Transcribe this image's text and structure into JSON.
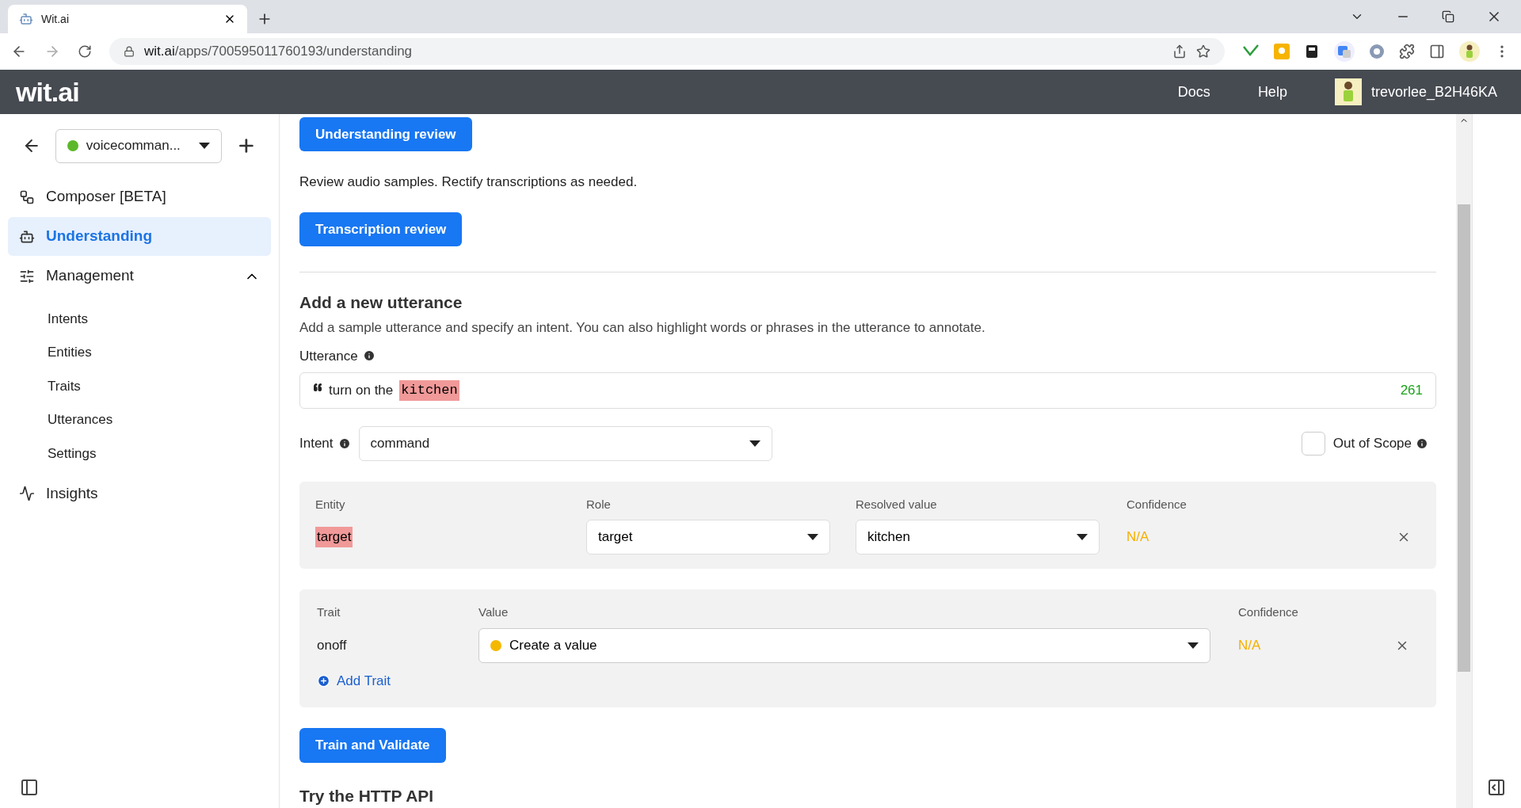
{
  "browser": {
    "tab": {
      "title": "Wit.ai"
    },
    "url": {
      "host": "wit.ai",
      "path": "/apps/700595011760193/understanding"
    }
  },
  "header": {
    "logo": "wit.ai",
    "links": [
      "Docs",
      "Help"
    ],
    "user": "trevorlee_B2H46KA"
  },
  "sidebar": {
    "app": {
      "name": "voicecomman...",
      "color": "#5cb82a"
    },
    "items": [
      {
        "label": "Composer [BETA]",
        "selected": false
      },
      {
        "label": "Understanding",
        "selected": true
      },
      {
        "label": "Management",
        "selected": false,
        "expanded": true,
        "children": [
          {
            "label": "Intents"
          },
          {
            "label": "Entities"
          },
          {
            "label": "Traits"
          },
          {
            "label": "Utterances"
          },
          {
            "label": "Settings"
          }
        ]
      },
      {
        "label": "Insights",
        "selected": false
      }
    ]
  },
  "main": {
    "understanding_review_button": "Understanding review",
    "review_text": "Review audio samples. Rectify transcriptions as needed.",
    "transcription_review_button": "Transcription review",
    "section_title": "Add a new utterance",
    "section_text": "Add a sample utterance and specify an intent. You can also highlight words or phrases in the utterance to annotate.",
    "utterance": {
      "label": "Utterance",
      "text": "turn on the",
      "highlight": "kitchen",
      "count": "261"
    },
    "intent": {
      "label": "Intent",
      "value": "command"
    },
    "out_of_scope": {
      "label": "Out of Scope",
      "checked": false
    },
    "entities": {
      "columns": [
        "Entity",
        "Role",
        "Resolved value",
        "Confidence"
      ],
      "rows": [
        {
          "entity": "target",
          "role": "target",
          "resolved": "kitchen",
          "confidence": "N/A"
        }
      ]
    },
    "traits": {
      "columns": [
        "Trait",
        "Value",
        "Confidence"
      ],
      "rows": [
        {
          "trait": "onoff",
          "value": "Create a value",
          "color": "#f5b800",
          "confidence": "N/A"
        }
      ],
      "add": "Add Trait"
    },
    "train_button": "Train and Validate",
    "api_title": "Try the HTTP API"
  }
}
